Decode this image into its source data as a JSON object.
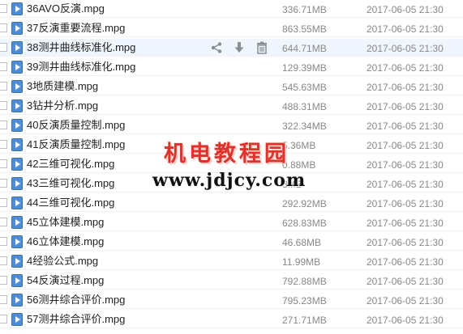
{
  "files": [
    {
      "name": "36AVO反演.mpg",
      "size": "336.71MB",
      "date": "2017-06-05 21:30"
    },
    {
      "name": "37反演重要流程.mpg",
      "size": "863.55MB",
      "date": "2017-06-05 21:30"
    },
    {
      "name": "38测井曲线标准化.mpg",
      "size": "644.71MB",
      "date": "2017-06-05 21:30"
    },
    {
      "name": "39测井曲线标准化.mpg",
      "size": "129.39MB",
      "date": "2017-06-05 21:30"
    },
    {
      "name": "3地质建模.mpg",
      "size": "545.63MB",
      "date": "2017-06-05 21:30"
    },
    {
      "name": "3钻井分析.mpg",
      "size": "488.31MB",
      "date": "2017-06-05 21:30"
    },
    {
      "name": "40反演质量控制.mpg",
      "size": "322.34MB",
      "date": "2017-06-05 21:30"
    },
    {
      "name": "41反演质量控制.mpg",
      "size": "5.36MB",
      "date": "2017-06-05 21:30"
    },
    {
      "name": "42三维可视化.mpg",
      "size": "0.88MB",
      "date": "2017-06-05 21:30"
    },
    {
      "name": "43三维可视化.mpg",
      "size": "8MB",
      "date": "2017-06-05 21:30"
    },
    {
      "name": "44三维可视化.mpg",
      "size": "292.92MB",
      "date": "2017-06-05 21:30"
    },
    {
      "name": "45立体建模.mpg",
      "size": "628.83MB",
      "date": "2017-06-05 21:30"
    },
    {
      "name": "46立体建模.mpg",
      "size": "46.68MB",
      "date": "2017-06-05 21:30"
    },
    {
      "name": "4经验公式.mpg",
      "size": "11.99MB",
      "date": "2017-06-05 21:30"
    },
    {
      "name": "54反演过程.mpg",
      "size": "792.88MB",
      "date": "2017-06-05 21:30"
    },
    {
      "name": "56测井综合评价.mpg",
      "size": "795.23MB",
      "date": "2017-06-05 21:30"
    },
    {
      "name": "57测井综合评价.mpg",
      "size": "271.71MB",
      "date": "2017-06-05 21:30"
    }
  ],
  "hover_row": 2,
  "row_actions": [
    "share-icon",
    "download-icon",
    "delete-icon"
  ],
  "file_icon": "video-file-icon",
  "colors": {
    "hover_bg": "#f0f6fd",
    "icon_blue": "#4f8ed6",
    "watermark_red": "#e0322d"
  },
  "watermark": {
    "title": "机电教程园",
    "url": "www.jdjcy.com"
  }
}
